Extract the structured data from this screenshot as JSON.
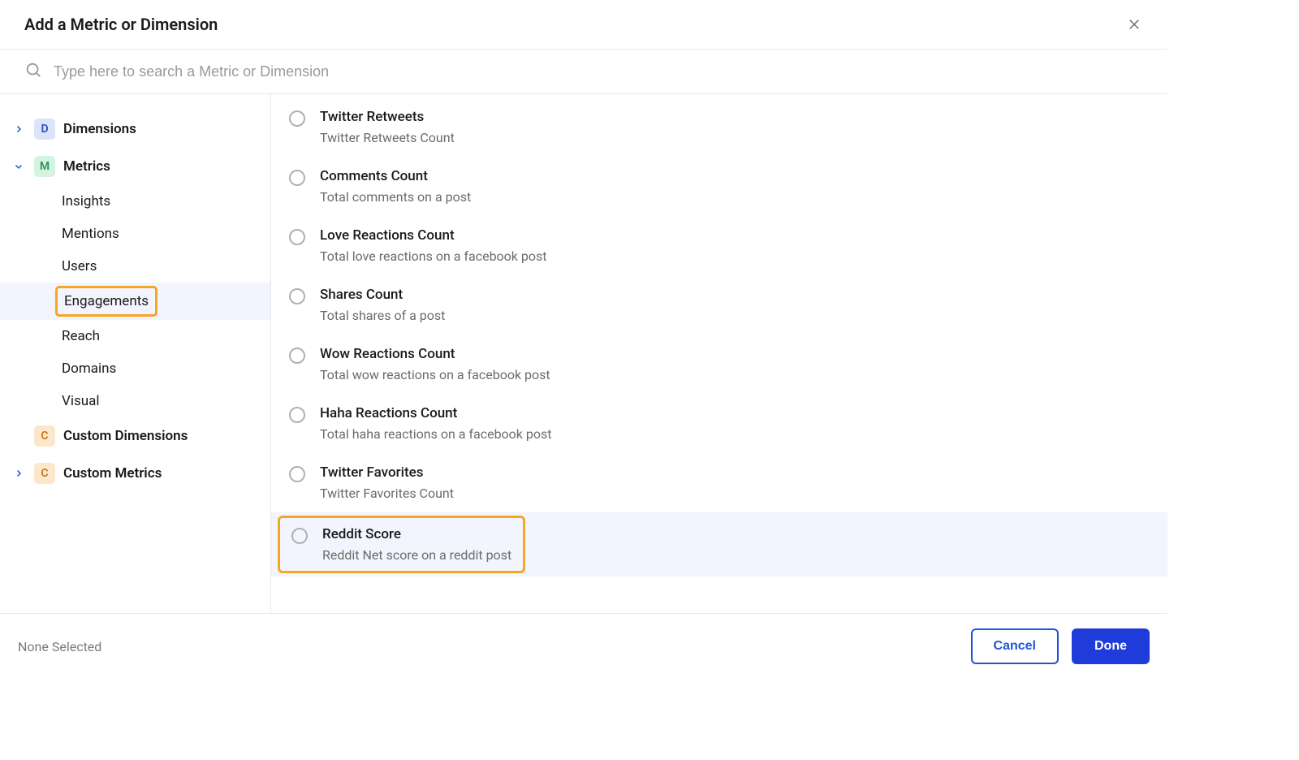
{
  "header": {
    "title": "Add a Metric or Dimension"
  },
  "search": {
    "placeholder": "Type here to search a Metric or Dimension"
  },
  "sidebar": {
    "dimensions_label": "Dimensions",
    "dimensions_badge": "D",
    "metrics_label": "Metrics",
    "metrics_badge": "M",
    "metric_children": [
      {
        "label": "Insights",
        "active": false
      },
      {
        "label": "Mentions",
        "active": false
      },
      {
        "label": "Users",
        "active": false
      },
      {
        "label": "Engagements",
        "active": true,
        "highlighted": true
      },
      {
        "label": "Reach",
        "active": false
      },
      {
        "label": "Domains",
        "active": false
      },
      {
        "label": "Visual",
        "active": false
      }
    ],
    "custom_dimensions_label": "Custom Dimensions",
    "custom_dimensions_badge": "C",
    "custom_metrics_label": "Custom Metrics",
    "custom_metrics_badge": "C"
  },
  "metrics": [
    {
      "title": "Twitter Retweets",
      "desc": "Twitter Retweets Count",
      "highlighted": false
    },
    {
      "title": "Comments Count",
      "desc": "Total comments on a post",
      "highlighted": false
    },
    {
      "title": "Love Reactions Count",
      "desc": "Total love reactions on a facebook post",
      "highlighted": false
    },
    {
      "title": "Shares Count",
      "desc": "Total shares of a post",
      "highlighted": false
    },
    {
      "title": "Wow Reactions Count",
      "desc": "Total wow reactions on a facebook post",
      "highlighted": false
    },
    {
      "title": "Haha Reactions Count",
      "desc": "Total haha reactions on a facebook post",
      "highlighted": false
    },
    {
      "title": "Twitter Favorites",
      "desc": "Twitter Favorites Count",
      "highlighted": false
    },
    {
      "title": "Reddit Score",
      "desc": "Reddit Net score on a reddit post",
      "highlighted": true
    }
  ],
  "footer": {
    "status": "None Selected",
    "cancel": "Cancel",
    "done": "Done"
  }
}
